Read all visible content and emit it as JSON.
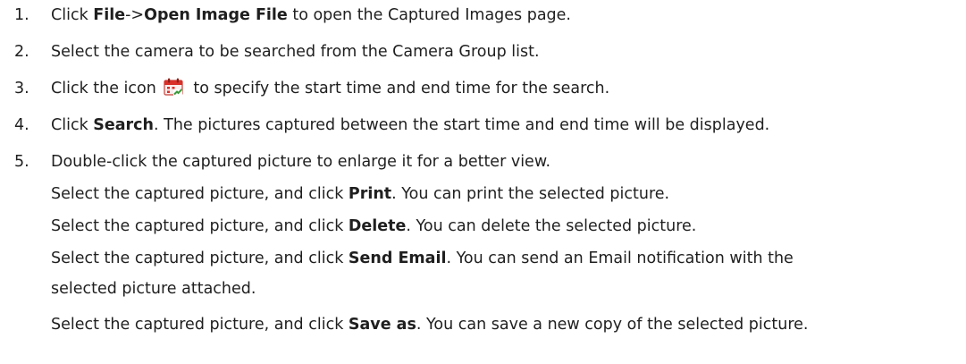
{
  "steps": [
    {
      "num": "1.",
      "pre": "Click ",
      "b1": "File",
      "mid": "->",
      "b2": "Open Image File",
      "post": " to open the Captured Images page."
    },
    {
      "num": "2.",
      "text": "Select the camera to be searched from the Camera Group list."
    },
    {
      "num": "3.",
      "pre": "Click the icon",
      "icon": "calendar-icon",
      "post": " to specify the start time and end time for the search."
    },
    {
      "num": "4.",
      "pre": "Click ",
      "bold": "Search",
      "post": ". The pictures captured between the start time and end time will be displayed."
    },
    {
      "num": "5.",
      "text": "Double-click the captured picture to enlarge it for a better view."
    }
  ],
  "subitems": [
    {
      "pre": "Select the captured picture, and click ",
      "bold": "Print",
      "post": ". You can print the selected picture."
    },
    {
      "pre": "Select the captured picture, and click ",
      "bold": "Delete",
      "post": ". You can delete the selected picture."
    },
    {
      "pre": "Select the captured picture, and click ",
      "bold": "Send Email",
      "post": ". You can send an Email notification with the",
      "cont": "selected picture attached."
    },
    {
      "pre": "Select the captured picture, and click ",
      "bold": "Save as",
      "post": ". You can save a new copy of the selected picture."
    }
  ],
  "colors": {
    "text": "#1f1f1f",
    "icon_red": "#d9302a",
    "icon_green": "#3a9a3a"
  }
}
